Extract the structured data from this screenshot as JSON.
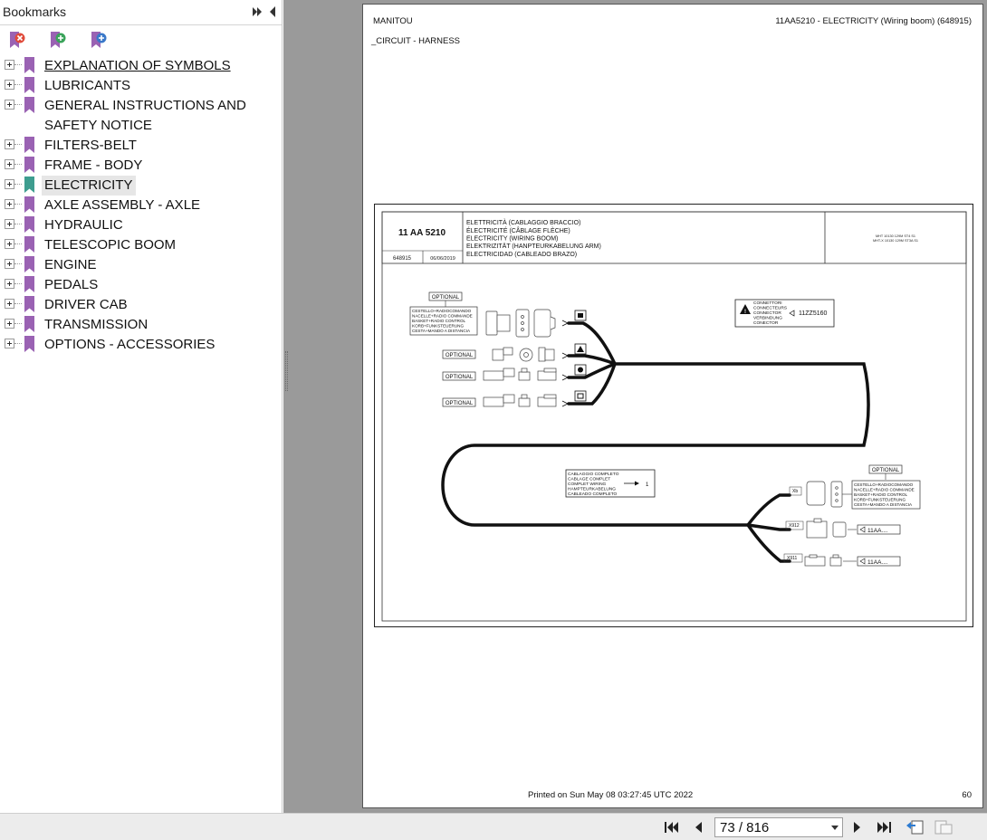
{
  "bookmarks_panel": {
    "title": "Bookmarks",
    "toolbar_icons": [
      "delete-bookmark-icon",
      "add-bookmark-icon",
      "add-child-bookmark-icon"
    ],
    "items": [
      {
        "label": "EXPLANATION OF SYMBOLS",
        "underlined": true
      },
      {
        "label": "LUBRICANTS"
      },
      {
        "label": "GENERAL INSTRUCTIONS AND SAFETY NOTICE",
        "tall": true
      },
      {
        "label": "FILTERS-BELT"
      },
      {
        "label": "FRAME - BODY"
      },
      {
        "label": "ELECTRICITY",
        "selected": true
      },
      {
        "label": "AXLE ASSEMBLY - AXLE"
      },
      {
        "label": "HYDRAULIC"
      },
      {
        "label": "TELESCOPIC BOOM"
      },
      {
        "label": "ENGINE"
      },
      {
        "label": "PEDALS"
      },
      {
        "label": "DRIVER CAB"
      },
      {
        "label": "TRANSMISSION"
      },
      {
        "label": "OPTIONS - ACCESSORIES"
      }
    ]
  },
  "document": {
    "header_left": "MANITOU",
    "header_right": "11AA5210 - ELECTRICITY (Wiring boom) (648915)",
    "subheader": "_CIRCUIT - HARNESS",
    "footer_printed": "Printed on  Sun May 08 03:27:45 UTC 2022",
    "footer_page": "60",
    "drawing": {
      "code": "11 AA 5210",
      "ref": "648915",
      "date": "06/06/2019",
      "titles": [
        "ELETTRICITÀ (CABLAGGIO BRACCIO)",
        "ÉLECTRICITÉ (CÂBLAGE FLÈCHE)",
        "ELECTRICITY (WIRING BOOM)",
        "ELEKTRIZITÄT (HANPTEURKABELUNG ARM)",
        "ELECTRICIDAD (CABLEADO BRAZO)"
      ],
      "models": [
        "MHT 10130 129M ST4 S1",
        "MHT-X 10130 129M ST3A S1"
      ],
      "optional": "OPTIONAL",
      "remote_lines": [
        "CESTELLO+RADIOCOMANDO",
        "NACELLE+RADIO COMMANDE",
        "BASKET+RADIO CONTROL",
        "KORB+FUNKSTEUERUNG",
        "CESTA+MANDO A DISTANCIA"
      ],
      "connector_lines": [
        "CONNETTORI",
        "CONNECTEURS",
        "CONNECTOR",
        "VERBINDUNG",
        "CONECTOR"
      ],
      "connector_ref": "11ZZ5160",
      "complete_lines": [
        "CABLAGGIO COMPLETO",
        "CABLAGE COMPLET",
        "COMPLET WIRING",
        "HAMPTEURKABELUNG",
        "CABLEADO COMPLETO"
      ],
      "complete_qty": "1",
      "tag_xb": "Xb",
      "tag_x912": "X912",
      "tag_x911": "X911",
      "ref_11aa": "11AA...."
    }
  },
  "navigation": {
    "page_display": "73 / 816",
    "current_page": 73,
    "total_pages": 816
  }
}
